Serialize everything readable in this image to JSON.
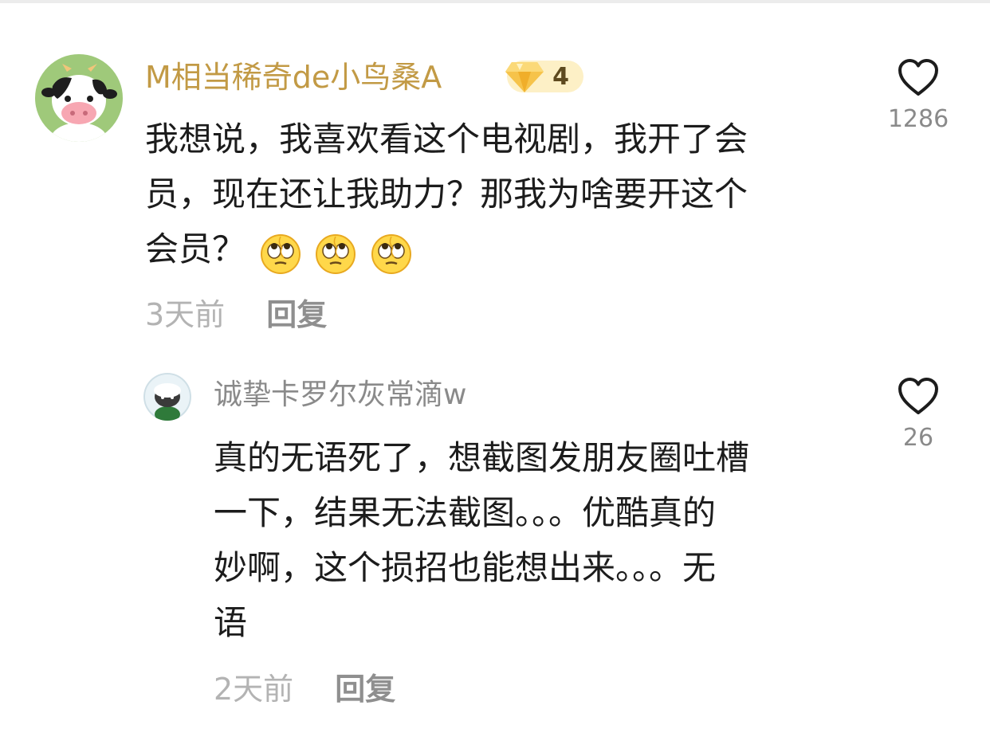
{
  "comments": [
    {
      "user": "M相当稀奇de小鸟桑A",
      "level": "4",
      "lines": [
        "我想说，我喜欢看这个电视剧，我开了会",
        "员，现在还让我助力？那我为啥要开这个",
        "会员？"
      ],
      "emoji": "eye-roll",
      "time": "3天前",
      "reply_label": "回复",
      "likes": "1286"
    },
    {
      "user": "诚挚卡罗尔灰常滴w",
      "lines": [
        "真的无语死了，想截图发朋友圈吐槽",
        "一下，结果无法截图。。。优酷真的",
        "妙啊，这个损招也能想出来。。。无",
        "语"
      ],
      "time": "2天前",
      "reply_label": "回复",
      "likes": "26"
    }
  ],
  "colors": {
    "username_vip": "#c29a45",
    "username": "#8a8a8a",
    "text": "#1c1c1c",
    "timestamp": "#b3b3b3",
    "reply": "#8f8f8f",
    "badge_bg": "#fdf0c6"
  },
  "icons": [
    "heart-outline-icon",
    "diamond-icon",
    "eye-roll-emoji"
  ]
}
